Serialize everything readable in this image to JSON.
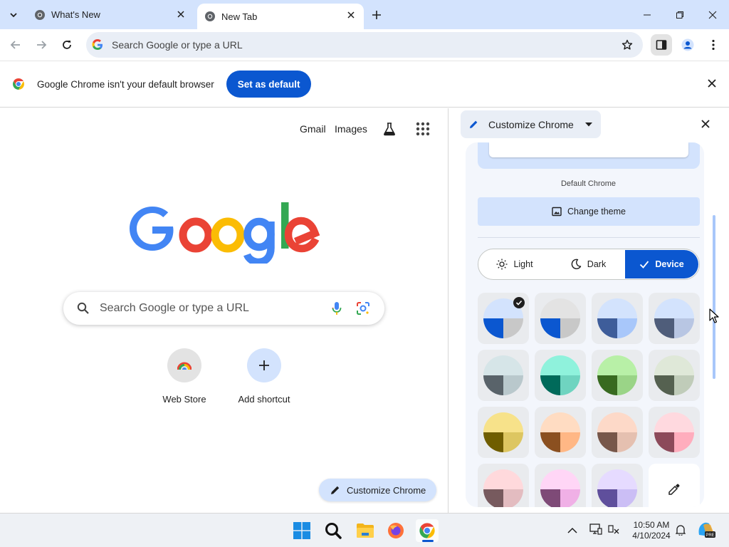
{
  "tabs": [
    {
      "title": "What's New",
      "active": false
    },
    {
      "title": "New Tab",
      "active": true
    }
  ],
  "toolbar": {
    "omnibox_placeholder": "Search Google or type a URL"
  },
  "infobar": {
    "message": "Google Chrome isn't your default browser",
    "button_label": "Set as default"
  },
  "ntp": {
    "links": {
      "gmail": "Gmail",
      "images": "Images"
    },
    "search_placeholder": "Search Google or type a URL",
    "shortcuts": [
      {
        "label": "Web Store",
        "icon": "chrome-web-store-icon"
      },
      {
        "label": "Add shortcut",
        "icon": "plus-icon"
      }
    ],
    "customize_label": "Customize Chrome"
  },
  "side_panel": {
    "title": "Customize Chrome",
    "theme_name": "Default Chrome",
    "change_theme_label": "Change theme",
    "modes": [
      {
        "label": "Light",
        "selected": false
      },
      {
        "label": "Dark",
        "selected": false
      },
      {
        "label": "Device",
        "selected": true
      }
    ],
    "color_swatches": [
      {
        "top": "#d3e3fd",
        "left": "#0b57d0",
        "right": "#c8c8c8",
        "selected": true
      },
      {
        "top": "#e3e3e3",
        "left": "#0b57d0",
        "right": "#c8c8c8",
        "selected": false
      },
      {
        "top": "#d3e3fd",
        "left": "#3e5d9a",
        "right": "#a8c7fa",
        "selected": false
      },
      {
        "top": "#d3e3fd",
        "left": "#4f5d7a",
        "right": "#b8c6e3",
        "selected": false
      },
      {
        "top": "#d6e5e8",
        "left": "#59636a",
        "right": "#b9c8cc",
        "selected": false
      },
      {
        "top": "#8ff2dc",
        "left": "#006a5a",
        "right": "#6fd4c0",
        "selected": false
      },
      {
        "top": "#b8f0a7",
        "left": "#386a20",
        "right": "#9ad487",
        "selected": false
      },
      {
        "top": "#dfe8d8",
        "left": "#556150",
        "right": "#c0ccb9",
        "selected": false
      },
      {
        "top": "#f7e28a",
        "left": "#6f5d00",
        "right": "#ddc661",
        "selected": false
      },
      {
        "top": "#ffdcc2",
        "left": "#8b5020",
        "right": "#ffb785",
        "selected": false
      },
      {
        "top": "#fdd9c8",
        "left": "#77574a",
        "right": "#e5c0b0",
        "selected": false
      },
      {
        "top": "#ffd9df",
        "left": "#8c4a5a",
        "right": "#ffadbd",
        "selected": false
      },
      {
        "top": "#ffd9dc",
        "left": "#775a5e",
        "right": "#e3bcc0",
        "selected": false
      },
      {
        "top": "#ffd6f6",
        "left": "#7e4a77",
        "right": "#f0b0e6",
        "selected": false
      },
      {
        "top": "#e6dbff",
        "left": "#5f4f9c",
        "right": "#cbbef5",
        "selected": false
      },
      {
        "top": "",
        "left": "",
        "right": "",
        "selected": false,
        "custom": "eyedropper-icon"
      }
    ]
  },
  "taskbar": {
    "apps": [
      "windows-start-icon",
      "search-icon",
      "file-explorer-icon",
      "firefox-icon",
      "chrome-icon"
    ],
    "time": "10:50 AM",
    "date": "4/10/2024"
  },
  "colors": {
    "accent": "#0b57d0",
    "tab_strip": "#d3e3fd",
    "omnibox_bg": "#e9eef6"
  }
}
